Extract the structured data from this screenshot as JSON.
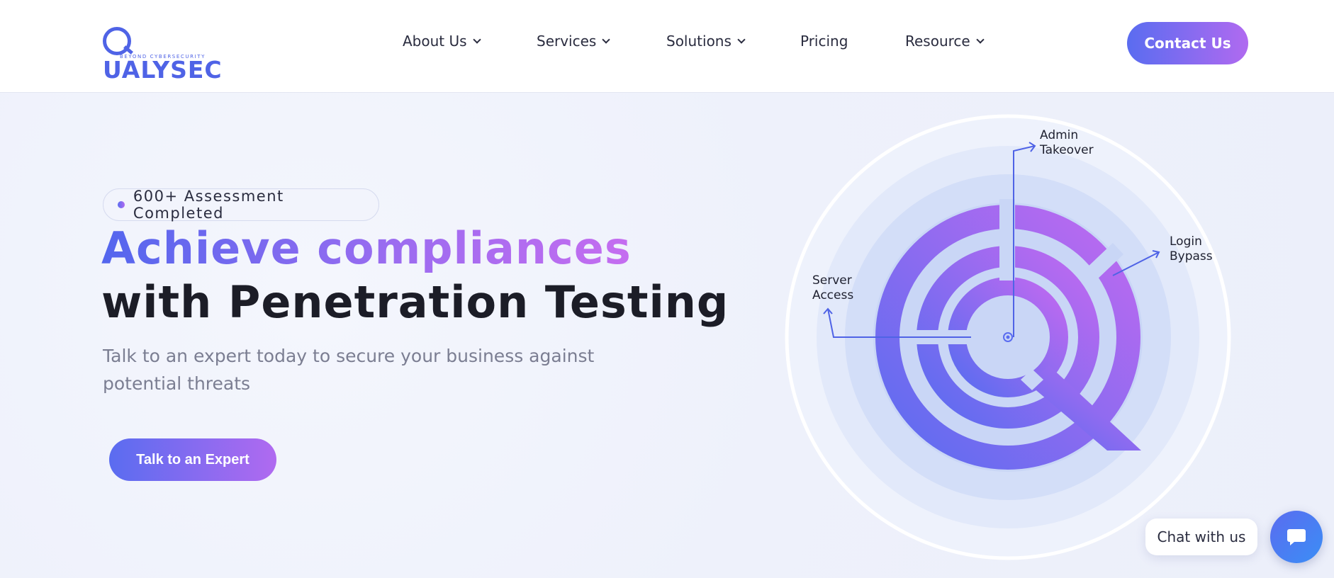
{
  "header": {
    "logo": {
      "word": "UALYSEC",
      "tagline": "BEYOND CYBERSECURITY"
    },
    "nav": [
      {
        "label": "About Us",
        "dropdown": true
      },
      {
        "label": "Services",
        "dropdown": true
      },
      {
        "label": "Solutions",
        "dropdown": true
      },
      {
        "label": "Pricing",
        "dropdown": false
      },
      {
        "label": "Resource",
        "dropdown": true
      }
    ],
    "contact_label": "Contact Us"
  },
  "hero": {
    "badge": "600+ Assessment Completed",
    "headline_line1": "Achieve compliances",
    "headline_line2": "with Penetration Testing",
    "subtext": "Talk to an expert today to secure your business against potential threats",
    "cta_label": "Talk to an Expert",
    "illustration_labels": {
      "admin": [
        "Admin",
        "Takeover"
      ],
      "login": [
        "Login",
        "Bypass"
      ],
      "server": [
        "Server",
        "Access"
      ]
    }
  },
  "chat": {
    "bubble_text": "Chat with us"
  },
  "colors": {
    "primary": "#5a6cf0",
    "accent": "#b06af0",
    "text_dark": "#1c1d27",
    "text_muted": "#7b7e92"
  },
  "icons": [
    "chevron-down-icon",
    "chat-icon",
    "logo-q-icon",
    "target-icon"
  ]
}
